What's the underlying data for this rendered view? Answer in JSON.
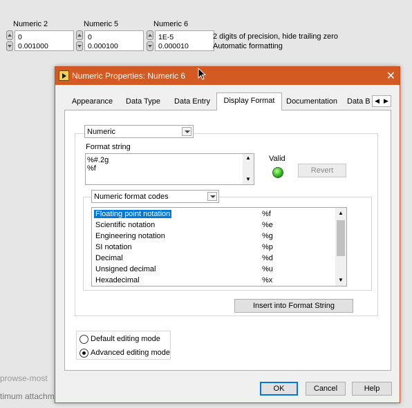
{
  "front_panel": {
    "controls": [
      {
        "label": "Numeric 2",
        "line1": "0",
        "line2": "0.001000"
      },
      {
        "label": "Numeric 5",
        "line1": "0",
        "line2": "0.000100"
      },
      {
        "label": "Numeric 6",
        "line1": "1E-5",
        "line2": "0.000010"
      }
    ],
    "note_line1": "2 digits of precision, hide trailing zero",
    "note_line2": "Automatic formatting",
    "background_fragments": [
      "prowse-most",
      "timum attachm"
    ]
  },
  "dialog": {
    "title": "Numeric Properties: Numeric 6",
    "tabs": [
      {
        "label": "Appearance",
        "active": false
      },
      {
        "label": "Data Type",
        "active": false
      },
      {
        "label": "Data Entry",
        "active": false
      },
      {
        "label": "Display Format",
        "active": true
      },
      {
        "label": "Documentation",
        "active": false
      },
      {
        "label": "Data B",
        "active": false
      }
    ],
    "type_select": "Numeric",
    "format_string_label": "Format string",
    "format_string_lines": [
      "%#.2g",
      "%f"
    ],
    "valid_label": "Valid",
    "revert_label": "Revert",
    "codes_select": "Numeric format codes",
    "codes": [
      {
        "name": "Floating point notation",
        "code": "%f",
        "selected": true
      },
      {
        "name": "Scientific notation",
        "code": "%e"
      },
      {
        "name": "Engineering notation",
        "code": "%g"
      },
      {
        "name": "SI notation",
        "code": "%p"
      },
      {
        "name": "Decimal",
        "code": "%d"
      },
      {
        "name": "Unsigned decimal",
        "code": "%u"
      },
      {
        "name": "Hexadecimal",
        "code": "%x"
      }
    ],
    "insert_label": "Insert into Format String",
    "default_mode_label": "Default editing mode",
    "advanced_mode_label": "Advanced editing mode",
    "advanced_selected": true,
    "ok_label": "OK",
    "cancel_label": "Cancel",
    "help_label": "Help"
  },
  "colors": {
    "titlebar": "#d35a22",
    "selection": "#0078d7",
    "led": "#22b512"
  }
}
